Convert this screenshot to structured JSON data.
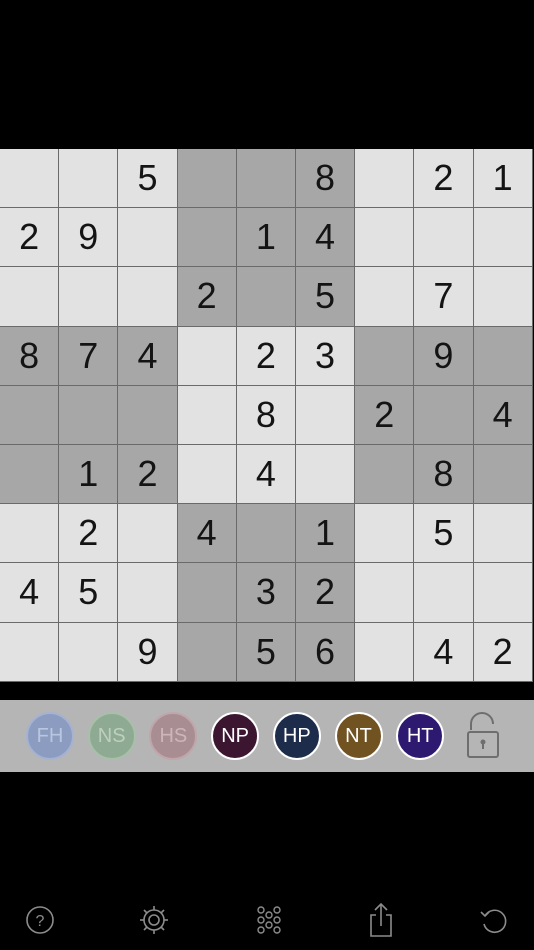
{
  "grid": {
    "cells": [
      [
        "",
        "",
        "5",
        "",
        "",
        "8",
        "",
        "2",
        "1"
      ],
      [
        "2",
        "9",
        "",
        "",
        "1",
        "4",
        "",
        "",
        ""
      ],
      [
        "",
        "",
        "",
        "2",
        "",
        "5",
        "",
        "7",
        ""
      ],
      [
        "8",
        "7",
        "4",
        "",
        "2",
        "3",
        "",
        "9",
        ""
      ],
      [
        "",
        "",
        "",
        "",
        "8",
        "",
        "2",
        "",
        "4"
      ],
      [
        "",
        "1",
        "2",
        "",
        "4",
        "",
        "",
        "8",
        ""
      ],
      [
        "",
        "2",
        "",
        "4",
        "",
        "1",
        "",
        "5",
        ""
      ],
      [
        "4",
        "5",
        "",
        "",
        "3",
        "2",
        "",
        "",
        ""
      ],
      [
        "",
        "",
        "9",
        "",
        "5",
        "6",
        "",
        "4",
        "2"
      ]
    ]
  },
  "toolbar": {
    "buttons": [
      {
        "label": "FH",
        "name": "fh-button",
        "bg": "#8c9cc0",
        "fg": "#b9c6e0",
        "border": "#a5b2d2"
      },
      {
        "label": "NS",
        "name": "ns-button",
        "bg": "#8faa92",
        "fg": "#bdd0bf",
        "border": "#a8c0aa"
      },
      {
        "label": "HS",
        "name": "hs-button",
        "bg": "#a88e93",
        "fg": "#cdb6ba",
        "border": "#c0a6ab"
      },
      {
        "label": "NP",
        "name": "np-button",
        "bg": "#3c1530",
        "fg": "#ffffff",
        "border": "#ffffff"
      },
      {
        "label": "HP",
        "name": "hp-button",
        "bg": "#1d2c4a",
        "fg": "#ffffff",
        "border": "#ffffff"
      },
      {
        "label": "NT",
        "name": "nt-button",
        "bg": "#715321",
        "fg": "#ffffff",
        "border": "#ffffff"
      },
      {
        "label": "HT",
        "name": "ht-button",
        "bg": "#2d1a70",
        "fg": "#ffffff",
        "border": "#ffffff"
      }
    ],
    "lock_icon": "unlocked-padlock-icon"
  },
  "bottom_bar": {
    "icons": [
      "help-icon",
      "settings-gear-icon",
      "grid-dots-icon",
      "share-icon",
      "undo-icon"
    ]
  },
  "colors": {
    "light_cell": "#e2e2e2",
    "dark_cell": "#a7a7a7",
    "digit": "#141414",
    "background": "#000000"
  }
}
